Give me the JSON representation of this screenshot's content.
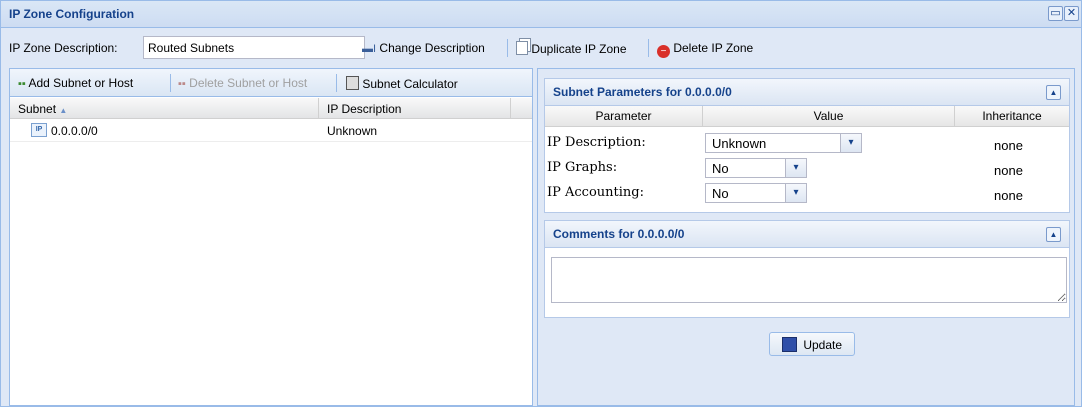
{
  "window": {
    "title": "IP Zone Configuration"
  },
  "toolbar": {
    "desc_label": "IP Zone Description:",
    "desc_value": "Routed Subnets",
    "change_desc": "Change Description",
    "duplicate": "Duplicate IP Zone",
    "delete": "Delete IP Zone"
  },
  "left": {
    "add_subnet": "Add Subnet or Host",
    "delete_subnet": "Delete Subnet or Host",
    "calculator": "Subnet Calculator",
    "columns": {
      "subnet": "Subnet",
      "ip_description": "IP Description"
    },
    "rows": [
      {
        "subnet": "0.0.0.0/0",
        "ip_description": "Unknown",
        "icon": "IP"
      }
    ]
  },
  "params": {
    "title": "Subnet Parameters for 0.0.0.0/0",
    "headers": {
      "parameter": "Parameter",
      "value": "Value",
      "inheritance": "Inheritance"
    },
    "rows": [
      {
        "label": "IP Description:",
        "value": "Unknown",
        "inheritance": "none"
      },
      {
        "label": "IP Graphs:",
        "value": "No",
        "inheritance": "none"
      },
      {
        "label": "IP Accounting:",
        "value": "No",
        "inheritance": "none"
      }
    ]
  },
  "comments": {
    "title": "Comments for 0.0.0.0/0",
    "value": ""
  },
  "update_label": "Update",
  "colors": {
    "header_text": "#15428b",
    "panel_bg": "#dfe8f6",
    "border": "#99bbe8"
  }
}
